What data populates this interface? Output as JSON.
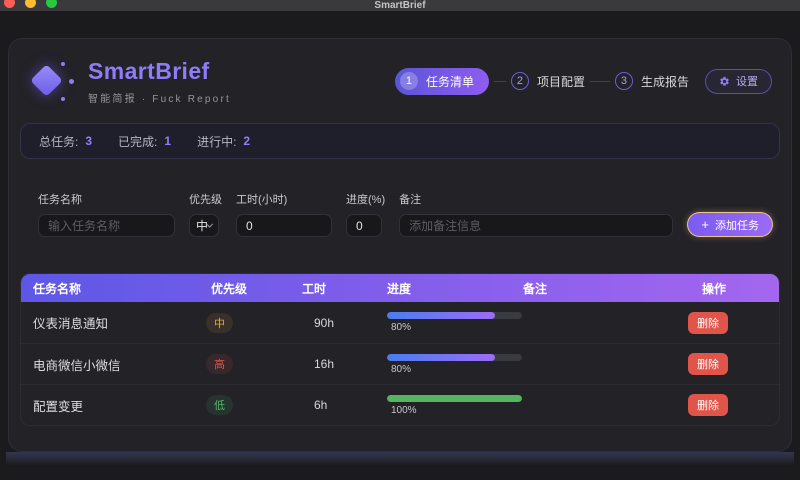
{
  "titlebar": {
    "title": "SmartBrief"
  },
  "brand": {
    "name": "SmartBrief",
    "tagline": "智能简报 · Fuck Report"
  },
  "stepper": {
    "steps": [
      {
        "num": "1",
        "label": "任务清单"
      },
      {
        "num": "2",
        "label": "项目配置"
      },
      {
        "num": "3",
        "label": "生成报告"
      }
    ]
  },
  "settings_button": {
    "label": "设置"
  },
  "stats": {
    "total": {
      "label": "总任务:",
      "value": "3"
    },
    "done": {
      "label": "已完成:",
      "value": "1"
    },
    "active": {
      "label": "进行中:",
      "value": "2"
    }
  },
  "form": {
    "task_name": {
      "label": "任务名称",
      "placeholder": "输入任务名称"
    },
    "priority": {
      "label": "优先级",
      "value": "中"
    },
    "hours": {
      "label": "工时(小时)",
      "value": "0"
    },
    "progress": {
      "label": "进度(%)",
      "value": "0"
    },
    "note": {
      "label": "备注",
      "placeholder": "添加备注信息"
    },
    "add_button": {
      "icon": "+",
      "label": "添加任务"
    }
  },
  "table": {
    "headers": {
      "name": "任务名称",
      "priority": "优先级",
      "hours": "工时",
      "progress": "进度",
      "note": "备注",
      "actions": "操作"
    },
    "rows": [
      {
        "name": "仪表消息通知",
        "priority": "中",
        "priority_color": "#e8a33d",
        "hours": "90h",
        "progress_pct": 80,
        "progress_label": "80%",
        "note": "",
        "bar_colors": [
          "#4a7df0",
          "#9b6cf6"
        ],
        "delete_label": "删除"
      },
      {
        "name": "电商微信小微信",
        "priority": "高",
        "priority_color": "#e0524a",
        "hours": "16h",
        "progress_pct": 80,
        "progress_label": "80%",
        "note": "",
        "bar_colors": [
          "#4a7df0",
          "#9b6cf6"
        ],
        "delete_label": "删除"
      },
      {
        "name": "配置变更",
        "priority": "低",
        "priority_color": "#55b86a",
        "hours": "6h",
        "progress_pct": 100,
        "progress_label": "100%",
        "note": "",
        "bar_colors": [
          "#55b45f",
          "#55b45f"
        ],
        "delete_label": "删除"
      }
    ]
  },
  "colors": {
    "accent": "#8b5cf6",
    "table_header_gradient": [
      "#5e57e6",
      "#a466ef"
    ],
    "danger": "#e0544a",
    "traffic_lights": [
      "#ff5f57",
      "#febc2e",
      "#28c840"
    ]
  }
}
